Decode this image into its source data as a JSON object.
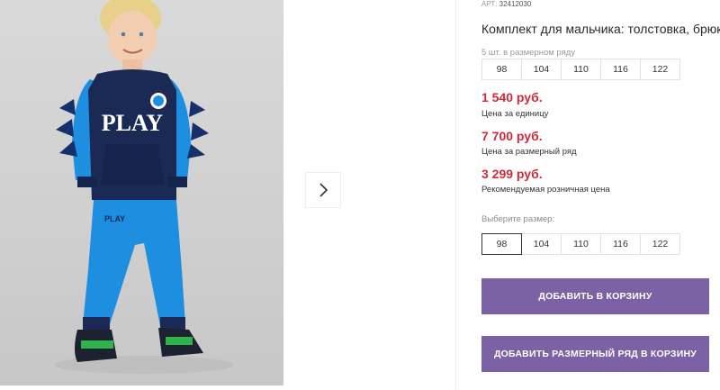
{
  "product": {
    "article_label": "АРТ:",
    "article_value": "32412030",
    "title": "Комплект для мальчика: толстовка, брюки",
    "row_note": "5 шт. в размерном ряду",
    "row_sizes": [
      "98",
      "104",
      "110",
      "116",
      "122"
    ],
    "sweatshirt_text": "PLAY"
  },
  "prices": {
    "unit_price": "1 540 руб.",
    "unit_label": "Цена за единицу",
    "row_price": "7 700 руб.",
    "row_label": "Цена за размерный ряд",
    "rrp_price": "3 299 руб.",
    "rrp_label": "Рекомендуемая розничная цена"
  },
  "size_select": {
    "label": "Выберите размер:",
    "options": [
      "98",
      "104",
      "110",
      "116",
      "122"
    ],
    "selected": "98"
  },
  "actions": {
    "add_to_cart": "ДОБАВИТЬ В КОРЗИНУ",
    "add_row_to_cart": "ДОБАВИТЬ РАЗМЕРНЫЙ РЯД В КОРЗИНУ"
  },
  "gallery": {
    "next_icon": "chevron-right-icon"
  },
  "colors": {
    "price_red": "#d2293a",
    "button_purple": "#7a62a4",
    "sweatshirt_navy": "#1a2a55",
    "sleeve_blue": "#1e8fe0"
  }
}
